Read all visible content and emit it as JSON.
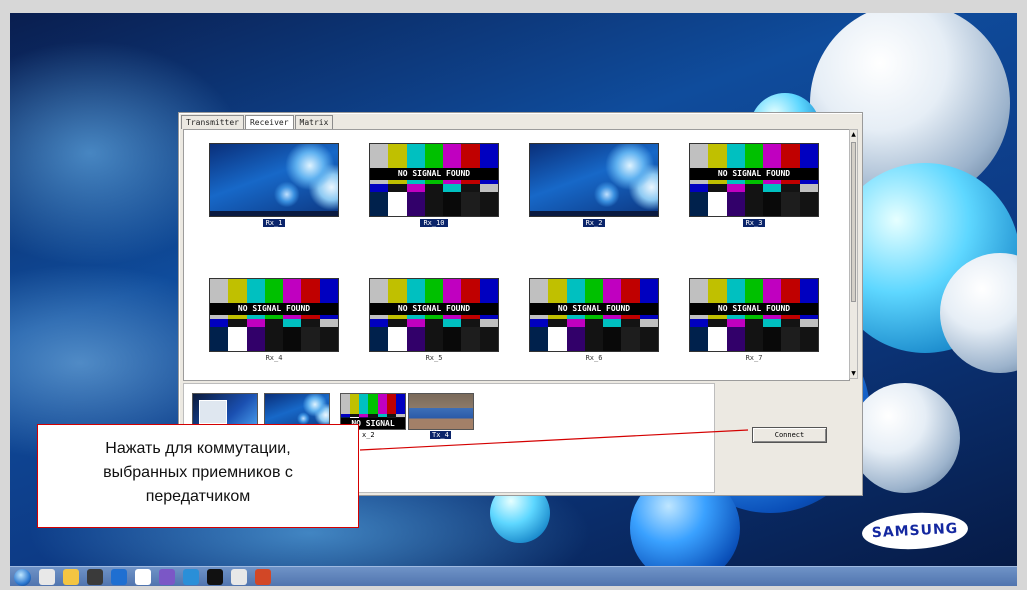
{
  "tabs": [
    "Transmitter",
    "Receiver",
    "Matrix"
  ],
  "active_tab": "Receiver",
  "no_signal_text": "NO SIGNAL FOUND",
  "receivers": [
    {
      "label": "Rx_1",
      "preview": "desktop",
      "selected": true
    },
    {
      "label": "Rx_10",
      "preview": "no-signal",
      "selected": true
    },
    {
      "label": "Rx_2",
      "preview": "desktop",
      "selected": true
    },
    {
      "label": "Rx_3",
      "preview": "no-signal",
      "selected": true
    },
    {
      "label": "Rx_4",
      "preview": "no-signal",
      "selected": false
    },
    {
      "label": "Rx_5",
      "preview": "no-signal",
      "selected": false
    },
    {
      "label": "Rx_6",
      "preview": "no-signal",
      "selected": false
    },
    {
      "label": "Rx_7",
      "preview": "no-signal",
      "selected": false
    }
  ],
  "transmitters": [
    {
      "label": "",
      "preview": "windows-desktop",
      "selected": false
    },
    {
      "label": "",
      "preview": "desktop",
      "selected": false
    },
    {
      "label": "x_2",
      "preview": "no-signal",
      "selected": false
    },
    {
      "label": "Tx_4",
      "preview": "room-camera",
      "selected": true
    }
  ],
  "connect_button": "Connect",
  "callout": {
    "lines": [
      "Нажать для коммутации,",
      "выбранных приемников с",
      "передатчиком"
    ]
  },
  "brand": "SAMSUNG",
  "colors": {
    "selection": "#0a246a",
    "callout_border": "#d40000",
    "leader_line": "#d40000",
    "bars_top": [
      "#c0c0c0",
      "#c0c000",
      "#00c0c0",
      "#00c000",
      "#c000c0",
      "#c00000",
      "#0000c0"
    ],
    "bars_mid": [
      "#0000c0",
      "#131313",
      "#c000c0",
      "#131313",
      "#00c0c0",
      "#131313",
      "#c0c0c0"
    ],
    "bars_bot": [
      "#00214c",
      "#ffffff",
      "#32006a",
      "#131313",
      "#090909",
      "#1d1d1d",
      "#131313"
    ]
  },
  "taskbar_icons": [
    "start-icon",
    "chrome-icon",
    "file-explorer-icon",
    "vnc-icon",
    "internet-explorer-icon",
    "document-icon",
    "viber-icon",
    "remote-desktop-icon",
    "command-prompt-icon",
    "java-icon",
    "powerpoint-icon"
  ]
}
